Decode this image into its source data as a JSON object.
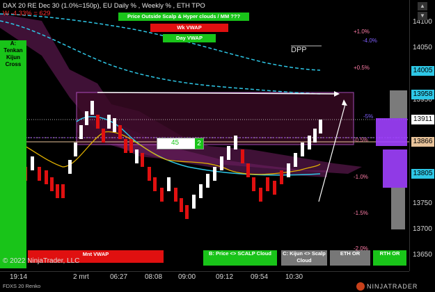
{
  "header": {
    "title": "DAX 20 RE Dec 30 (1.0%=150p), EU Daily % , Weekly % , ETH TPO",
    "subtitle": "W -4.33% = 629"
  },
  "left_panel": {
    "lines": [
      "A:",
      "Tenkan",
      "Kijun",
      "Cross"
    ]
  },
  "banners": {
    "price_outside": "Price Outside Scalp & Hyper clouds / MM ???",
    "wk_vwap": "Wk VWAP",
    "day_vwap": "Day VWAP",
    "dpp": "DPP",
    "mnt_vwap": "Mnt VWAP"
  },
  "percent_labels": {
    "p1": "+1.0%",
    "m4": "-4.0%",
    "p05": "+0.5%",
    "m5": "-5%",
    "m05": "-0.5%",
    "m1": "-1.0%",
    "m15": "-1.5%",
    "m2": "-2.0%"
  },
  "counter": {
    "value": "45",
    "badge": "2"
  },
  "price_axis": {
    "ticks": [
      "14100",
      "14050",
      "13950",
      "13750",
      "13700",
      "13650"
    ],
    "badges": [
      {
        "label": "14005",
        "color": "#2ec7e6"
      },
      {
        "label": "13958",
        "color": "#2ec7e6"
      },
      {
        "label": "13911",
        "color": "#ffffff"
      },
      {
        "label": "13866",
        "color": "#e8c39a"
      },
      {
        "label": "13805",
        "color": "#2ec7e6"
      }
    ]
  },
  "time_axis": {
    "labels": [
      "19:14",
      "2 mrt",
      "06:27",
      "08:08",
      "09:00",
      "09:12",
      "09:54",
      "10:30"
    ]
  },
  "buttons": {
    "b_scalp": "B: Price <> SCALP Cloud",
    "c_kijun": "C: Kijun <> Scalp Cloud",
    "eth_or": "ETH OR",
    "rth_or": "RTH OR"
  },
  "footer": {
    "copyright": "© 2022 NinjaTrader, LLC",
    "renko": "FDXS 20 Renko",
    "brand": "NINJATRADER"
  },
  "colors": {
    "cyan": "#2ec7e6",
    "cloud": "#5a1a4a",
    "green": "#19c419",
    "red": "#e01010",
    "purple": "#a040ff",
    "yellow": "#e0b000"
  },
  "icons": [
    "scroll-up-icon",
    "scroll-down-icon",
    "ninjatrader-logo-icon"
  ]
}
